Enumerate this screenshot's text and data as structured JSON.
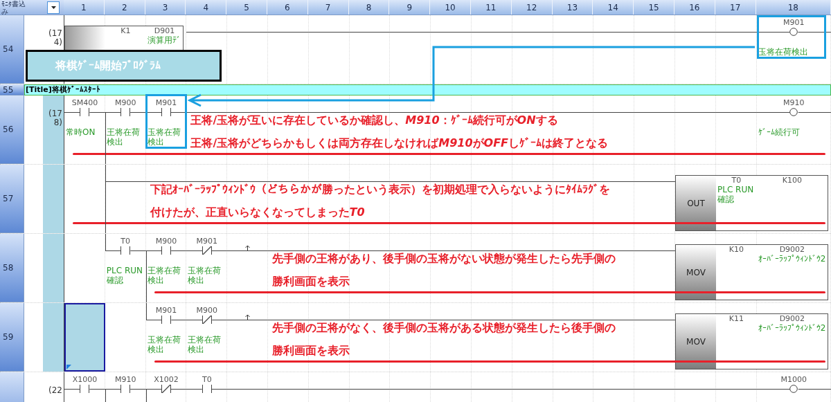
{
  "header": {
    "corner": "ﾓﾆﾀ書込み",
    "columns": [
      "1",
      "2",
      "3",
      "4",
      "5",
      "6",
      "7",
      "8",
      "9",
      "10",
      "11",
      "12",
      "13",
      "14",
      "15",
      "16",
      "17",
      "18"
    ]
  },
  "rows": [
    {
      "kind": "ladder",
      "number": "54",
      "step": "(174)",
      "step_highlight": false,
      "callout": "将棋ｹﾞｰﾑ開始ﾌﾟﾛｸﾞﾗﾑ",
      "cells": [
        {
          "kind": "instruction",
          "operands": [
            {
              "device": "K1"
            },
            {
              "device": "D901",
              "comment": "演算用ﾃﾞ"
            }
          ]
        },
        {
          "kind": "wire"
        },
        {
          "kind": "wire"
        },
        {
          "kind": "wire"
        },
        {
          "kind": "wire"
        },
        {
          "kind": "wire"
        },
        {
          "kind": "wire"
        },
        {
          "kind": "wire"
        },
        {
          "kind": "wire"
        },
        {
          "kind": "wire"
        },
        {
          "kind": "wire"
        },
        {
          "kind": "wire"
        },
        {
          "kind": "wire"
        },
        {
          "kind": "wire"
        },
        {
          "kind": "wire"
        },
        {
          "kind": "coil",
          "device": "M901",
          "comment": "玉将在荷検出",
          "highlighted": true
        }
      ]
    },
    {
      "kind": "title",
      "number": "55",
      "text": "[Title]将棋ｹﾞｰﾑｽﾀｰﾄ"
    },
    {
      "kind": "ladder",
      "number": "56",
      "step": "(178)",
      "step_highlight": true,
      "cells": [
        {
          "kind": "contact",
          "device": "SM400",
          "comment": "常時ON",
          "normally_closed": false,
          "highlighted": false,
          "underline_start": true
        },
        {
          "kind": "contact",
          "device": "M900",
          "comment": "王将在荷検出",
          "normally_closed": false,
          "highlighted": false,
          "branch_down": true
        },
        {
          "kind": "contact",
          "device": "M901",
          "comment": "玉将在荷検出",
          "normally_closed": false,
          "highlighted": true
        },
        {
          "kind": "wire",
          "note": [
            [
              {
                "text": "王将/玉将が互いに存在しているか確認し、"
              },
              {
                "text": "M910",
                "italic": true
              },
              {
                "text": "：ｹﾞｰﾑ続行可が"
              },
              {
                "text": "ON",
                "italic": true
              },
              {
                "text": "する"
              }
            ],
            [
              {
                "text": "王将/玉将がどちらかもしくは両方存在しなければ"
              },
              {
                "text": "M910",
                "italic": true
              },
              {
                "text": "が"
              },
              {
                "text": "OFF",
                "italic": true
              },
              {
                "text": "しｹﾞｰﾑは終了となる"
              }
            ]
          ]
        },
        {
          "kind": "wire"
        },
        {
          "kind": "wire"
        },
        {
          "kind": "wire"
        },
        {
          "kind": "wire"
        },
        {
          "kind": "wire"
        },
        {
          "kind": "wire"
        },
        {
          "kind": "wire"
        },
        {
          "kind": "wire"
        },
        {
          "kind": "wire"
        },
        {
          "kind": "wire"
        },
        {
          "kind": "wire"
        },
        {
          "kind": "wire"
        },
        {
          "kind": "wire"
        },
        {
          "kind": "coil",
          "device": "M910",
          "comment": "ｹﾞｰﾑ続行可",
          "highlighted": false
        }
      ]
    },
    {
      "kind": "ladder",
      "number": "57",
      "step_highlight": true,
      "cells": [
        {
          "kind": "blank",
          "underline_start": true
        },
        {
          "kind": "wire",
          "branch_up": true,
          "branch_down": true
        },
        {
          "kind": "wire",
          "note": [
            [
              {
                "text": "下記ｵｰﾊﾞｰﾗｯﾌﾟｳｨﾝﾄﾞｳ（どちらかが勝ったという表示）を初期処理で入らないようにﾀｲﾑﾗｸﾞを"
              }
            ],
            [
              {
                "text": "付けたが、正直いらなくなってしまった"
              },
              {
                "text": "T0",
                "italic": true
              }
            ]
          ]
        },
        {
          "kind": "wire"
        },
        {
          "kind": "wire"
        },
        {
          "kind": "wire"
        },
        {
          "kind": "wire"
        },
        {
          "kind": "wire"
        },
        {
          "kind": "wire"
        },
        {
          "kind": "wire"
        },
        {
          "kind": "wire"
        },
        {
          "kind": "wire"
        },
        {
          "kind": "wire"
        },
        {
          "kind": "wire"
        },
        {
          "kind": "wire"
        },
        {
          "kind": "instruction",
          "mnemonic": "OUT",
          "operands": [
            {
              "device": "T0",
              "comment": "PLC RUN確認"
            },
            {
              "device": "K100"
            }
          ]
        }
      ]
    },
    {
      "kind": "ladder",
      "number": "58",
      "step_highlight": true,
      "cells": [
        {
          "kind": "blank"
        },
        {
          "kind": "contact",
          "device": "T0",
          "comment": "PLC RUN確認",
          "normally_closed": false,
          "highlighted": false,
          "branch_up": true
        },
        {
          "kind": "contact",
          "device": "M900",
          "comment": "王将在荷検出",
          "normally_closed": false,
          "highlighted": false,
          "branch_down": true,
          "underline_start": true
        },
        {
          "kind": "contact",
          "device": "M901",
          "comment": "玉将在荷検出",
          "normally_closed": true,
          "highlighted": false
        },
        {
          "kind": "arrow"
        },
        {
          "kind": "wire",
          "note": [
            [
              {
                "text": "先手側の王将があり、後手側の玉将がない状態が発生したら先手側の"
              }
            ],
            [
              {
                "text": "勝利画面を表示"
              }
            ]
          ]
        },
        {
          "kind": "wire"
        },
        {
          "kind": "wire"
        },
        {
          "kind": "wire"
        },
        {
          "kind": "wire"
        },
        {
          "kind": "wire"
        },
        {
          "kind": "wire"
        },
        {
          "kind": "wire"
        },
        {
          "kind": "wire"
        },
        {
          "kind": "wire"
        },
        {
          "kind": "instruction",
          "mnemonic": "MOV",
          "operands": [
            {
              "device": "K10"
            },
            {
              "device": "D9002",
              "comment": "ｵｰﾊﾞｰﾗｯﾌﾟｳｨﾝﾄﾞｳ2"
            }
          ]
        }
      ]
    },
    {
      "kind": "ladder",
      "number": "59",
      "step_highlight": true,
      "cells": [
        {
          "kind": "cursor",
          "selected": true
        },
        {
          "kind": "blank"
        },
        {
          "kind": "contact",
          "device": "M901",
          "comment": "玉将在荷検出",
          "normally_closed": false,
          "highlighted": false,
          "branch_up": true,
          "underline_start": true
        },
        {
          "kind": "contact",
          "device": "M900",
          "comment": "王将在荷検出",
          "normally_closed": true,
          "highlighted": false
        },
        {
          "kind": "arrow"
        },
        {
          "kind": "wire",
          "note": [
            [
              {
                "text": "先手側の王将がなく、後手側の玉将がある状態が発生したら後手側の"
              }
            ],
            [
              {
                "text": "勝利画面を表示"
              }
            ]
          ]
        },
        {
          "kind": "wire"
        },
        {
          "kind": "wire"
        },
        {
          "kind": "wire"
        },
        {
          "kind": "wire"
        },
        {
          "kind": "wire"
        },
        {
          "kind": "wire"
        },
        {
          "kind": "wire"
        },
        {
          "kind": "wire"
        },
        {
          "kind": "wire"
        },
        {
          "kind": "instruction",
          "mnemonic": "MOV",
          "operands": [
            {
              "device": "K11"
            },
            {
              "device": "D9002",
              "comment": "ｵｰﾊﾞｰﾗｯﾌﾟｳｨﾝﾄﾞｳ2"
            }
          ]
        }
      ]
    },
    {
      "kind": "ladder",
      "step": "(22",
      "step_highlight": false,
      "cells": [
        {
          "kind": "contact",
          "device": "X1000",
          "normally_closed": false,
          "highlighted": false
        },
        {
          "kind": "contact",
          "device": "M910",
          "normally_closed": false,
          "highlighted": false,
          "branch_down": true
        },
        {
          "kind": "contact",
          "device": "X1002",
          "normally_closed": true,
          "highlighted": false,
          "branch_down": true
        },
        {
          "kind": "contact",
          "device": "T0",
          "normally_closed": false,
          "highlighted": false
        },
        {
          "kind": "wire"
        },
        {
          "kind": "wire"
        },
        {
          "kind": "wire"
        },
        {
          "kind": "wire"
        },
        {
          "kind": "wire"
        },
        {
          "kind": "wire"
        },
        {
          "kind": "wire"
        },
        {
          "kind": "wire"
        },
        {
          "kind": "wire"
        },
        {
          "kind": "wire"
        },
        {
          "kind": "wire"
        },
        {
          "kind": "wire"
        },
        {
          "kind": "wire"
        },
        {
          "kind": "coil",
          "device": "M1000",
          "highlighted": false
        }
      ]
    }
  ]
}
